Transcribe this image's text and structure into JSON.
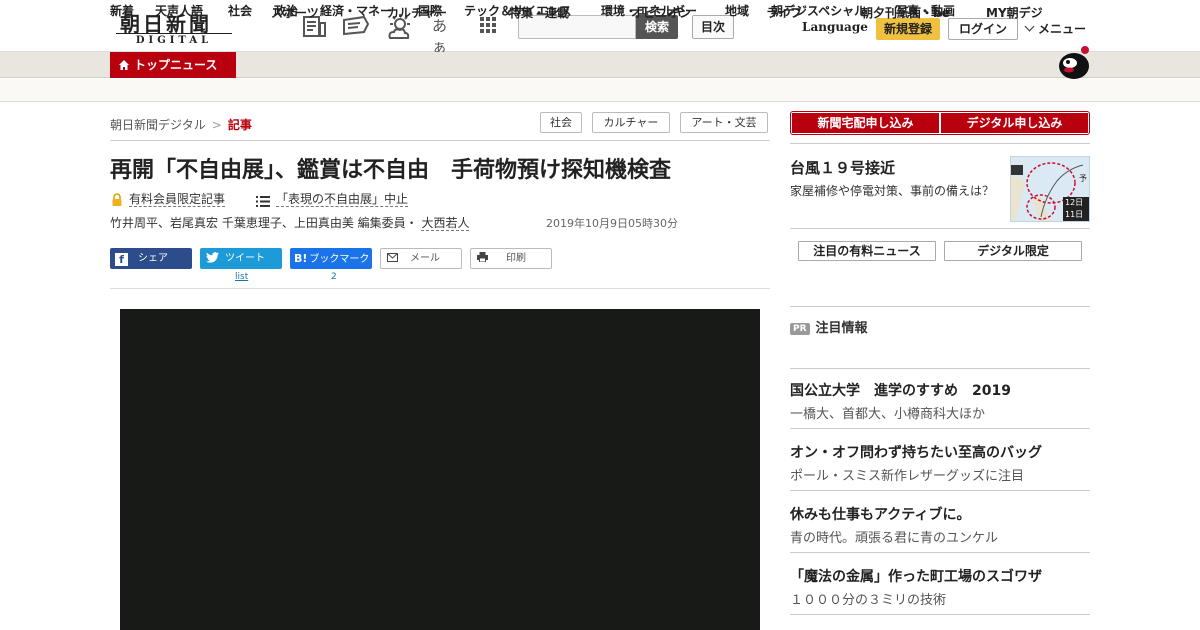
{
  "header": {
    "logo_main": "朝日新聞",
    "logo_sub": "DIGITAL",
    "search_button": "検索",
    "toc_button": "目次",
    "language": "Language",
    "register": "新規登録",
    "login": "ログイン",
    "menu": "メニュー",
    "font_size_icon_label": "あぁ"
  },
  "nav_main": {
    "active": "トップニュース",
    "items": [
      "スポーツ",
      "カルチャー",
      "特集・連載",
      "オピニオン",
      "ライフ",
      "朝夕刊紙面・be",
      "MY朝デジ"
    ]
  },
  "nav_sub": {
    "items": [
      "新着",
      "天声人語",
      "社会",
      "政治",
      "経済・マネー",
      "国際",
      "テック＆サイエンス",
      "環境・エネルギー",
      "地域",
      "朝デジスペシャル",
      "写真・動画"
    ]
  },
  "breadcrumb": {
    "home": "朝日新聞デジタル",
    "sep": ">",
    "current": "記事"
  },
  "tags": [
    "社会",
    "カルチャー",
    "アート・文芸"
  ],
  "article": {
    "title": "再開「不自由展」、鑑賞は不自由　手荷物預け探知機検査",
    "members_only": "有料会員限定記事",
    "series": "「表現の不自由展」中止",
    "authors_plain": "竹井周平、岩尾真宏 千葉恵理子、上田真由美 編集委員・",
    "author_link": "大西若人",
    "date": "2019年10月9日05時30分"
  },
  "share": {
    "facebook": "シェア",
    "twitter": "ツイート",
    "twitter_count": "list",
    "hatena": "ブックマーク",
    "hatena_count": "2",
    "mail": "メール",
    "print": "印刷"
  },
  "sidebar": {
    "subscribe_paper": "新聞宅配申し込み",
    "subscribe_digital": "デジタル申し込み",
    "typhoon_title": "台風１９号接近",
    "typhoon_desc": "家屋補修や停電対策、事前の備えは？",
    "typhoon_map_labels": [
      "12日1",
      "11日1",
      "予"
    ],
    "pill_paid": "注目の有料ニュース",
    "pill_digital": "デジタル限定",
    "pr_badge": "PR",
    "pr_heading": "注目情報",
    "pr_items": [
      {
        "title": "国公立大学　進学のすすめ　2019",
        "sub": "一橋大、首都大、小樽商科大ほか"
      },
      {
        "title": "オン・オフ問わず持ちたい至高のバッグ",
        "sub": "ポール・スミス新作レザーグッズに注目"
      },
      {
        "title": "休みも仕事もアクティブに。",
        "sub": "青の時代。頑張る君に青のユンケル"
      },
      {
        "title": "「魔法の金属」作った町工場のスゴワザ",
        "sub": "１０００分の３ミリの技術"
      }
    ]
  },
  "colors": {
    "brand_red": "#b8000e",
    "register_yellow": "#f0c040",
    "facebook": "#2d4c8c",
    "twitter": "#1d9bd9",
    "hatena": "#1a73e8"
  },
  "icons": [
    "news-icon",
    "flag-icon",
    "weather-icon",
    "font-size-icon",
    "grid-icon",
    "home-icon",
    "lock-icon",
    "list-icon",
    "facebook-icon",
    "twitter-icon",
    "hatena-icon",
    "mail-icon",
    "print-icon",
    "mascot-icon"
  ]
}
